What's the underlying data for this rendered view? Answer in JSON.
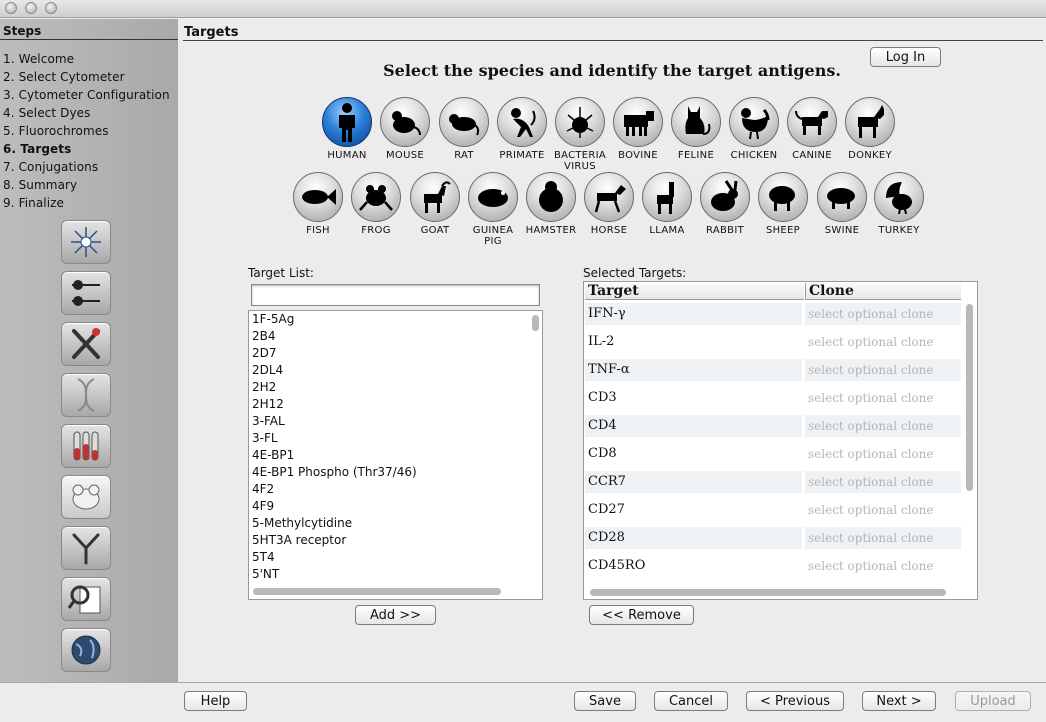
{
  "sidebar": {
    "title": "Steps",
    "steps": [
      {
        "label": "1. Welcome"
      },
      {
        "label": "2. Select Cytometer"
      },
      {
        "label": "3. Cytometer Configuration"
      },
      {
        "label": "4. Select Dyes"
      },
      {
        "label": "5. Fluorochromes"
      },
      {
        "label": "6. Targets"
      },
      {
        "label": "7. Conjugations"
      },
      {
        "label": "8. Summary"
      },
      {
        "label": "9. Finalize"
      }
    ],
    "current_step": "6. Targets",
    "icons": [
      "cytometer-icon",
      "laser-icon",
      "tools-icon",
      "dna-icon",
      "test-tubes-icon",
      "mouse-icon",
      "antibody-icon",
      "magnifier-report-icon",
      "globe-icon"
    ]
  },
  "header": {
    "title": "Targets",
    "login_label": "Log In"
  },
  "instructions": "Select the species and identify the target antigens.",
  "species_row1": [
    {
      "label": "HUMAN",
      "icon": "human-icon",
      "selected": true
    },
    {
      "label": "MOUSE",
      "icon": "mouse-icon"
    },
    {
      "label": "RAT",
      "icon": "rat-icon"
    },
    {
      "label": "PRIMATE",
      "icon": "primate-icon"
    },
    {
      "label": "BACTERIA",
      "label2": "VIRUS",
      "icon": "bacteria-virus-icon"
    },
    {
      "label": "BOVINE",
      "icon": "bovine-icon"
    },
    {
      "label": "FELINE",
      "icon": "feline-icon"
    },
    {
      "label": "CHICKEN",
      "icon": "chicken-icon"
    },
    {
      "label": "CANINE",
      "icon": "canine-icon"
    },
    {
      "label": "DONKEY",
      "icon": "donkey-icon"
    }
  ],
  "species_row2": [
    {
      "label": "FISH",
      "icon": "fish-icon"
    },
    {
      "label": "FROG",
      "icon": "frog-icon"
    },
    {
      "label": "GOAT",
      "icon": "goat-icon"
    },
    {
      "label": "GUINEA",
      "label2": "PIG",
      "icon": "guinea-pig-icon"
    },
    {
      "label": "HAMSTER",
      "icon": "hamster-icon"
    },
    {
      "label": "HORSE",
      "icon": "horse-icon"
    },
    {
      "label": "LLAMA",
      "icon": "llama-icon"
    },
    {
      "label": "RABBIT",
      "icon": "rabbit-icon"
    },
    {
      "label": "SHEEP",
      "icon": "sheep-icon"
    },
    {
      "label": "SWINE",
      "icon": "swine-icon"
    },
    {
      "label": "TURKEY",
      "icon": "turkey-icon"
    }
  ],
  "target_list": {
    "label": "Target List:",
    "search_value": "",
    "items": [
      "1F-5Ag",
      "2B4",
      "2D7",
      "2DL4",
      "2H2",
      "2H12",
      "3-FAL",
      "3-FL",
      "4E-BP1",
      "4E-BP1 Phospho (Thr37/46)",
      "4F2",
      "4F9",
      "5-Methylcytidine",
      "5HT3A receptor",
      "5T4",
      "5'NT"
    ],
    "add_label": "Add >>"
  },
  "selected_targets": {
    "label": "Selected Targets:",
    "col_target": "Target",
    "col_clone": "Clone",
    "rows": [
      {
        "target": "IFN-γ",
        "clone": "select optional clone"
      },
      {
        "target": "IL-2",
        "clone": "select optional clone"
      },
      {
        "target": "TNF-α",
        "clone": "select optional clone"
      },
      {
        "target": "CD3",
        "clone": "select optional clone"
      },
      {
        "target": "CD4",
        "clone": "select optional clone"
      },
      {
        "target": "CD8",
        "clone": "select optional clone"
      },
      {
        "target": "CCR7",
        "clone": "select optional clone"
      },
      {
        "target": "CD27",
        "clone": "select optional clone"
      },
      {
        "target": "CD28",
        "clone": "select optional clone"
      },
      {
        "target": "CD45RO",
        "clone": "select optional clone"
      }
    ],
    "remove_label": "<< Remove"
  },
  "footer": {
    "help": "Help",
    "save": "Save",
    "cancel": "Cancel",
    "previous": "< Previous",
    "next": "Next >",
    "upload": "Upload"
  }
}
